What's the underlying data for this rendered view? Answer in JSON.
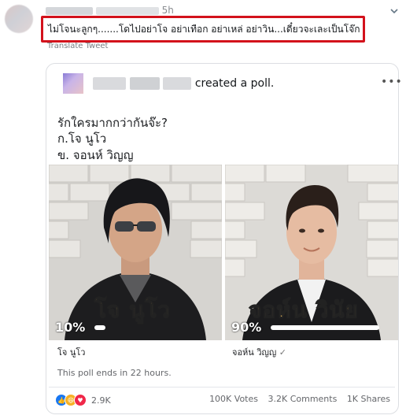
{
  "tweet": {
    "time": "5h",
    "text": "ไม่โจนะลูกๆ.......โดไปอย่าโจ อย่าเทือก อย่าเหล่ อย่าวิน...เดี๋ยวจะเละเป็นโจ๊ก",
    "translate_label": "Translate Tweet",
    "highlight_color": "#d3121c"
  },
  "poll": {
    "action_text": "created a poll.",
    "question": "รักใครมากกว่ากันจ๊ะ?",
    "option_a_line": "ก.โจ นูโว",
    "option_b_line": "ข. จอนห์ วิญญ",
    "options": [
      {
        "name": "โจ นูโว",
        "percent_label": "10%",
        "percent": 10,
        "caption": "โจ นูโว"
      },
      {
        "name": "จอห์น วิญญ",
        "percent_label": "90%",
        "percent": 90,
        "caption": "จอห์น วินัย"
      }
    ],
    "ends_text": "This poll ends in 22 hours.",
    "reaction_count": "2.9K",
    "votes": "100K Votes",
    "comments": "3.2K Comments",
    "shares": "1K Shares"
  }
}
